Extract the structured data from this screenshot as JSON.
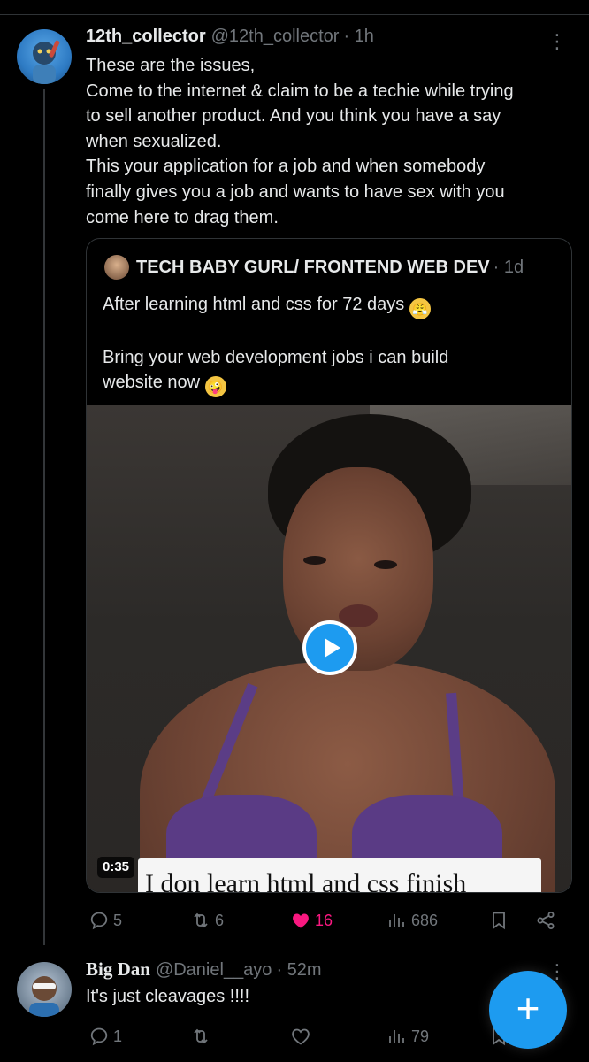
{
  "tweet": {
    "author_name": "12th_collector",
    "author_handle": "@12th_collector",
    "time": "· 1h",
    "text_lines": [
      "These are the issues,",
      "Come to the internet & claim to be a techie while trying",
      "to sell another product. And you think you have a say",
      "when sexualized.",
      "This your application for a job and when somebody",
      "finally gives you a job and wants to have sex with you",
      "come here to drag them."
    ],
    "quote": {
      "author_name": "TECH BABY GURL/ FRONTEND WEB DEV",
      "time": "· 1d",
      "text_lines": [
        "After learning html and css for 72 days",
        "",
        "Bring your web development jobs i can build",
        "website now"
      ],
      "video_duration": "0:35",
      "video_caption": "I don learn html and css finish"
    },
    "actions": {
      "replies": "5",
      "reposts": "6",
      "likes": "16",
      "views": "686"
    }
  },
  "reply": {
    "author_name": "Big Dan",
    "author_handle": "@Daniel__ayo",
    "time": "· 52m",
    "text": "It's just cleavages !!!!",
    "actions": {
      "replies": "1",
      "views": "79"
    }
  },
  "compose_button": {
    "label": "+"
  },
  "colors": {
    "background": "#000000",
    "text": "#e7e9ea",
    "muted": "#71767b",
    "accent": "#1d9bf0",
    "like": "#f91880",
    "border": "#2f3336"
  }
}
